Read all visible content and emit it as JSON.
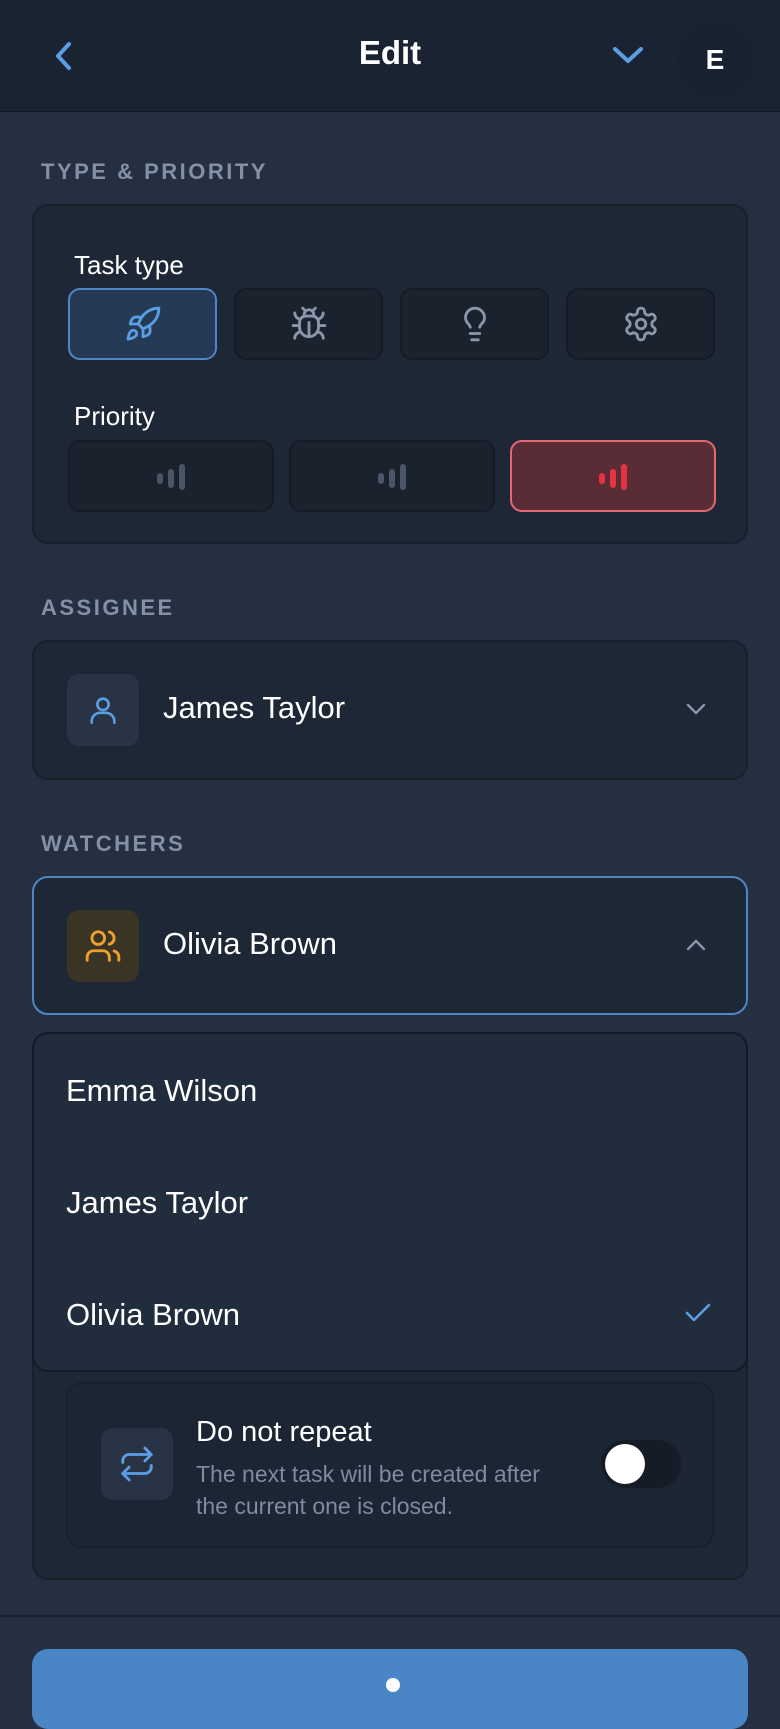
{
  "header": {
    "title": "Edit",
    "avatar_initial": "E",
    "back_icon": "chevron-left-icon",
    "collapse_icon": "chevron-down-icon"
  },
  "type_priority": {
    "section_label": "TYPE & PRIORITY",
    "task_type_label": "Task type",
    "task_types": [
      {
        "icon": "rocket-icon",
        "selected": true
      },
      {
        "icon": "bug-icon",
        "selected": false
      },
      {
        "icon": "lightbulb-icon",
        "selected": false
      },
      {
        "icon": "gear-icon",
        "selected": false
      }
    ],
    "priority_label": "Priority",
    "priorities": [
      {
        "icon": "signal-bars-icon",
        "selected": false
      },
      {
        "icon": "signal-bars-icon",
        "selected": false
      },
      {
        "icon": "signal-bars-icon",
        "selected": true
      }
    ]
  },
  "assignee": {
    "section_label": "ASSIGNEE",
    "value": "James Taylor",
    "icon": "user-icon"
  },
  "watchers": {
    "section_label": "WATCHERS",
    "value": "Olivia Brown",
    "icon": "users-icon",
    "options": [
      {
        "label": "Emma Wilson",
        "selected": false
      },
      {
        "label": "James Taylor",
        "selected": false
      },
      {
        "label": "Olivia Brown",
        "selected": true
      }
    ]
  },
  "repeat": {
    "title": "Do not repeat",
    "description": "The next task will be created after the current one is closed.",
    "enabled": false,
    "icon": "repeat-icon"
  },
  "colors": {
    "accent": "#4f86c6",
    "priority_high": "#e8323f",
    "watcher_icon": "#f0a030",
    "background": "#242f41"
  }
}
